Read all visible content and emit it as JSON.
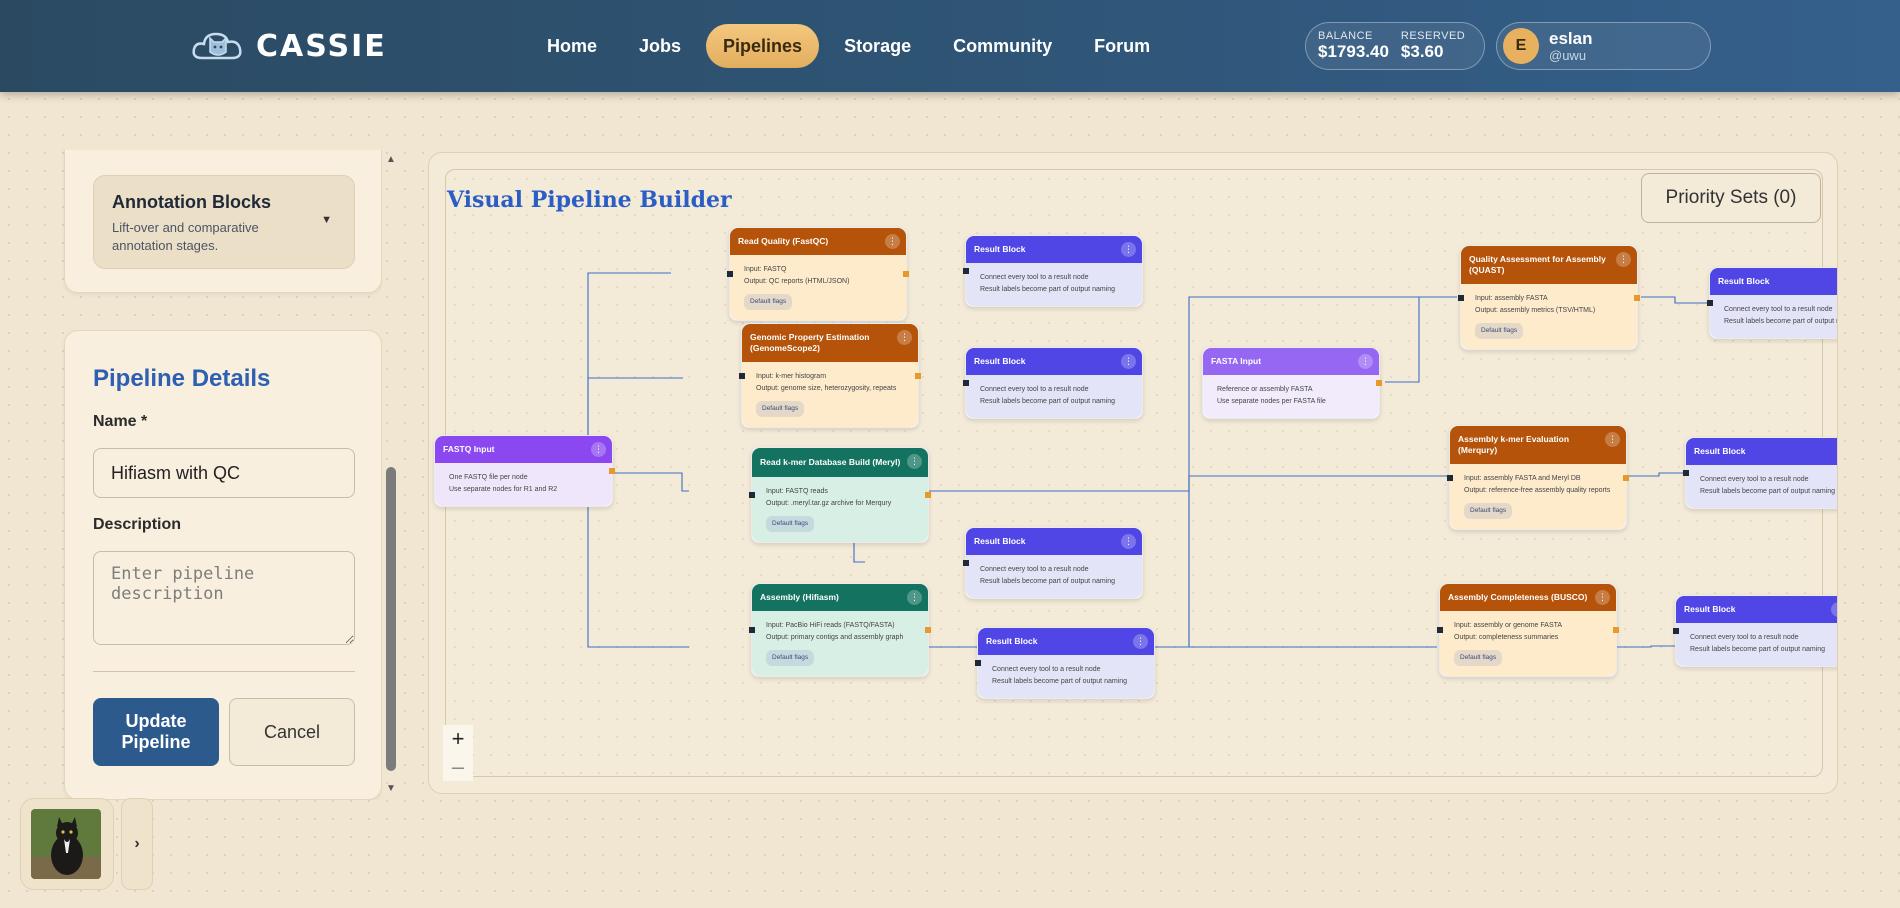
{
  "header": {
    "brand": "CASSIE",
    "nav": [
      {
        "label": "Home",
        "active": false
      },
      {
        "label": "Jobs",
        "active": false
      },
      {
        "label": "Pipelines",
        "active": true
      },
      {
        "label": "Storage",
        "active": false
      },
      {
        "label": "Community",
        "active": false
      },
      {
        "label": "Forum",
        "active": false
      }
    ],
    "balance_label": "BALANCE",
    "balance_value": "$1793.40",
    "reserved_label": "RESERVED",
    "reserved_value": "$3.60",
    "user": {
      "initial": "E",
      "name": "eslan",
      "handle": "@uwu"
    }
  },
  "sidebar": {
    "annotation_block": {
      "title": "Annotation Blocks",
      "description": "Lift-over and comparative annotation stages."
    },
    "details": {
      "title": "Pipeline Details",
      "name_label": "Name *",
      "name_value": "Hifiasm with QC",
      "description_label": "Description",
      "description_placeholder": "Enter pipeline description",
      "update_label": "Update Pipeline",
      "cancel_label": "Cancel"
    }
  },
  "canvas": {
    "title": "Visual Pipeline Builder",
    "priority_label": "Priority Sets (0)",
    "zoom_in": "+",
    "zoom_out": "–",
    "nodes": {
      "fastq": {
        "title": "FASTQ Input",
        "lines": [
          "One FASTQ file per node",
          "Use separate nodes for R1 and R2"
        ]
      },
      "fastqc": {
        "title": "Read Quality (FastQC)",
        "lines": [
          "Input: FASTQ",
          "Output: QC reports (HTML/JSON)"
        ],
        "flag": "Default flags"
      },
      "genomescope": {
        "title": "Genomic Property Estimation (GenomeScope2)",
        "lines": [
          "Input: k-mer histogram",
          "Output: genome size, heterozygosity, repeats"
        ],
        "flag": "Default flags"
      },
      "meryl": {
        "title": "Read k-mer Database Build (Meryl)",
        "lines": [
          "Input: FASTQ reads",
          "Output: .meryl.tar.gz archive for Merqury"
        ],
        "flag": "Default flags"
      },
      "hifiasm": {
        "title": "Assembly (Hifiasm)",
        "lines": [
          "Input: PacBio HiFi reads (FASTQ/FASTA)",
          "Output: primary contigs and assembly graph"
        ],
        "flag": "Default flags"
      },
      "fasta": {
        "title": "FASTA Input",
        "lines": [
          "Reference or assembly FASTA",
          "Use separate nodes per FASTA file"
        ]
      },
      "quast": {
        "title": "Quality Assessment for Assembly (QUAST)",
        "lines": [
          "Input: assembly FASTA",
          "Output: assembly metrics (TSV/HTML)"
        ],
        "flag": "Default flags"
      },
      "merqury": {
        "title": "Assembly k-mer Evaluation (Merqury)",
        "lines": [
          "Input: assembly FASTA and Meryl DB",
          "Output: reference-free assembly quality reports"
        ],
        "flag": "Default flags"
      },
      "busco": {
        "title": "Assembly Completeness (BUSCO)",
        "lines": [
          "Input: assembly or genome FASTA",
          "Output: completeness summaries"
        ],
        "flag": "Default flags"
      },
      "result": {
        "title": "Result Block",
        "lines": [
          "Connect every tool to a result node",
          "Result labels become part of output naming"
        ]
      }
    }
  },
  "colors": {
    "header": "#2f5577",
    "active_nav": "#e3ad5e",
    "input_node": "#8b48f0",
    "tool_node": "#b45309",
    "teal_node": "#137360",
    "result_node": "#4f46e5",
    "edge": "#3b6fc4"
  }
}
